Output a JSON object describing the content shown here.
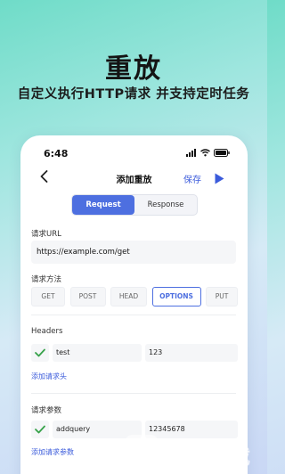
{
  "hero": {
    "title": "重放",
    "subtitle": "自定义执行HTTP请求 并支持定时任务"
  },
  "status_bar": {
    "time": "6:48"
  },
  "nav": {
    "back_icon": "chevron-left-icon",
    "title": "添加重放",
    "save_label": "保存",
    "play_icon": "play-icon"
  },
  "tabs": [
    {
      "label": "Request",
      "active": true
    },
    {
      "label": "Response",
      "active": false
    }
  ],
  "url": {
    "label": "请求URL",
    "value": "https://example.com/get"
  },
  "method": {
    "label": "请求方法",
    "options": [
      "GET",
      "POST",
      "HEAD",
      "OPTIONS",
      "PUT"
    ],
    "selected": "OPTIONS"
  },
  "headers": {
    "label": "Headers",
    "rows": [
      {
        "checked": true,
        "key": "test",
        "value": "123"
      }
    ],
    "add_label": "添加请求头"
  },
  "params": {
    "label": "请求参数",
    "rows": [
      {
        "checked": true,
        "key": "addquery",
        "value": "12345678"
      }
    ],
    "add_label": "添加请求参数"
  },
  "colors": {
    "accent": "#4d6fe0",
    "link": "#3b5bdb",
    "check": "#37a24a"
  },
  "watermark": {
    "text": "一听下载"
  }
}
